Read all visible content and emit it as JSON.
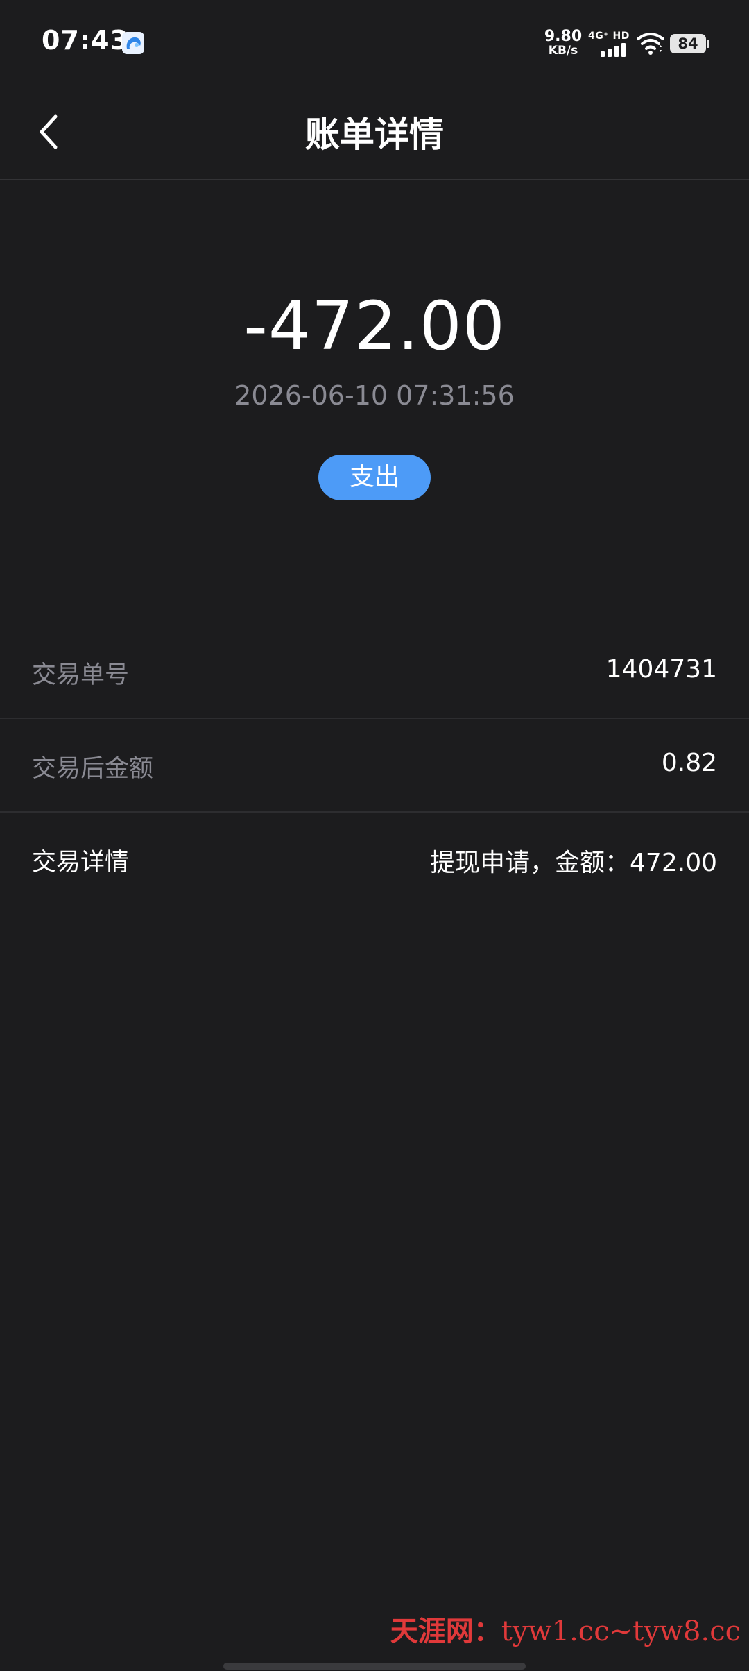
{
  "status_bar": {
    "time": "07:43",
    "net_speed_value": "9.80",
    "net_speed_unit": "KB/s",
    "network_type": "4G⁺ HD",
    "battery_level": "84",
    "icons": [
      "app-notification-icon",
      "signal-bars-icon",
      "wifi-icon",
      "battery-icon"
    ]
  },
  "header": {
    "title": "账单详情",
    "back_icon": "chevron-left-icon"
  },
  "summary": {
    "amount": "-472.00",
    "datetime": "2026-06-10 07:31:56",
    "type_label": "支出",
    "pill_color": "#4d9bf7"
  },
  "details": [
    {
      "label": "交易单号",
      "value": "1404731"
    },
    {
      "label": "交易后金额",
      "value": "0.82"
    },
    {
      "label": "交易详情",
      "value": "提现申请，金额：472.00"
    }
  ],
  "watermark": {
    "brand": "天涯网：",
    "text": "tyw1.cc~tyw8.cc",
    "color": "#e0393a"
  },
  "colors": {
    "background": "#1c1c1e",
    "muted_text": "#8a8a93",
    "divider": "#2d2d30"
  }
}
